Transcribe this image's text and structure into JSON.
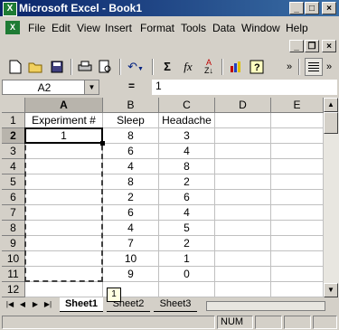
{
  "window": {
    "title": "Microsoft Excel - Book1",
    "app_icon": "X"
  },
  "menu": [
    "File",
    "Edit",
    "View",
    "Insert",
    "Format",
    "Tools",
    "Data",
    "Window",
    "Help"
  ],
  "toolbar": {
    "font_size_hint": "Σ",
    "fx": "fx",
    "overflow": "»"
  },
  "formula_bar": {
    "name_box": "A2",
    "equals": "=",
    "content": "1"
  },
  "grid": {
    "columns": [
      "A",
      "B",
      "C",
      "D",
      "E"
    ],
    "rows": [
      "1",
      "2",
      "3",
      "4",
      "5",
      "6",
      "7",
      "8",
      "9",
      "10",
      "11",
      "12"
    ],
    "data": [
      [
        "Experiment #",
        "Sleep",
        "Headache",
        "",
        ""
      ],
      [
        "1",
        "8",
        "3",
        "",
        ""
      ],
      [
        "",
        "6",
        "4",
        "",
        ""
      ],
      [
        "",
        "4",
        "8",
        "",
        ""
      ],
      [
        "",
        "8",
        "2",
        "",
        ""
      ],
      [
        "",
        "2",
        "6",
        "",
        ""
      ],
      [
        "",
        "6",
        "4",
        "",
        ""
      ],
      [
        "",
        "4",
        "5",
        "",
        ""
      ],
      [
        "",
        "7",
        "2",
        "",
        ""
      ],
      [
        "",
        "10",
        "1",
        "",
        ""
      ],
      [
        "",
        "9",
        "0",
        "",
        ""
      ],
      [
        "",
        "",
        "",
        "",
        ""
      ]
    ],
    "active_cell": "A2",
    "fill_tooltip": "1"
  },
  "sheets": [
    "Sheet1",
    "Sheet2",
    "Sheet3"
  ],
  "status": {
    "num": "NUM"
  },
  "colors": {
    "title_start": "#0a246a",
    "title_end": "#3a6ea5",
    "face": "#d4d0c8"
  }
}
